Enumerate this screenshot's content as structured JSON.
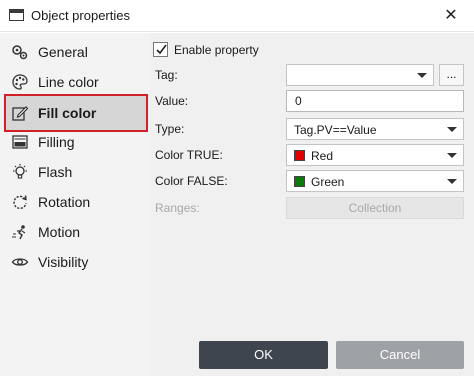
{
  "window": {
    "title": "Object properties",
    "close_glyph": "✕"
  },
  "sidebar": {
    "items": [
      {
        "label": "General",
        "icon": "gears-icon"
      },
      {
        "label": "Line color",
        "icon": "palette-icon"
      },
      {
        "label": "Fill color",
        "icon": "fill-pencil-icon",
        "selected": true
      },
      {
        "label": "Filling",
        "icon": "filling-icon"
      },
      {
        "label": "Flash",
        "icon": "flash-bulb-icon"
      },
      {
        "label": "Rotation",
        "icon": "rotation-icon"
      },
      {
        "label": "Motion",
        "icon": "motion-icon"
      },
      {
        "label": "Visibility",
        "icon": "eye-icon"
      }
    ]
  },
  "form": {
    "enable_property": {
      "label": "Enable property",
      "checked": true
    },
    "tag": {
      "label": "Tag:",
      "value": "",
      "browse": "..."
    },
    "value": {
      "label": "Value:",
      "value": "0"
    },
    "type": {
      "label": "Type:",
      "value": "Tag.PV==Value"
    },
    "color_true": {
      "label": "Color TRUE:",
      "value": "Red",
      "color": "#e00000"
    },
    "color_false": {
      "label": "Color FALSE:",
      "value": "Green",
      "color": "#0a7a0a"
    },
    "ranges": {
      "label": "Ranges:",
      "button": "Collection",
      "enabled": false
    }
  },
  "buttons": {
    "ok": "OK",
    "cancel": "Cancel"
  },
  "colors": {
    "selection_outline": "#d0202a",
    "ok_bg": "#3f454e",
    "cancel_bg": "#9ea1a5"
  }
}
